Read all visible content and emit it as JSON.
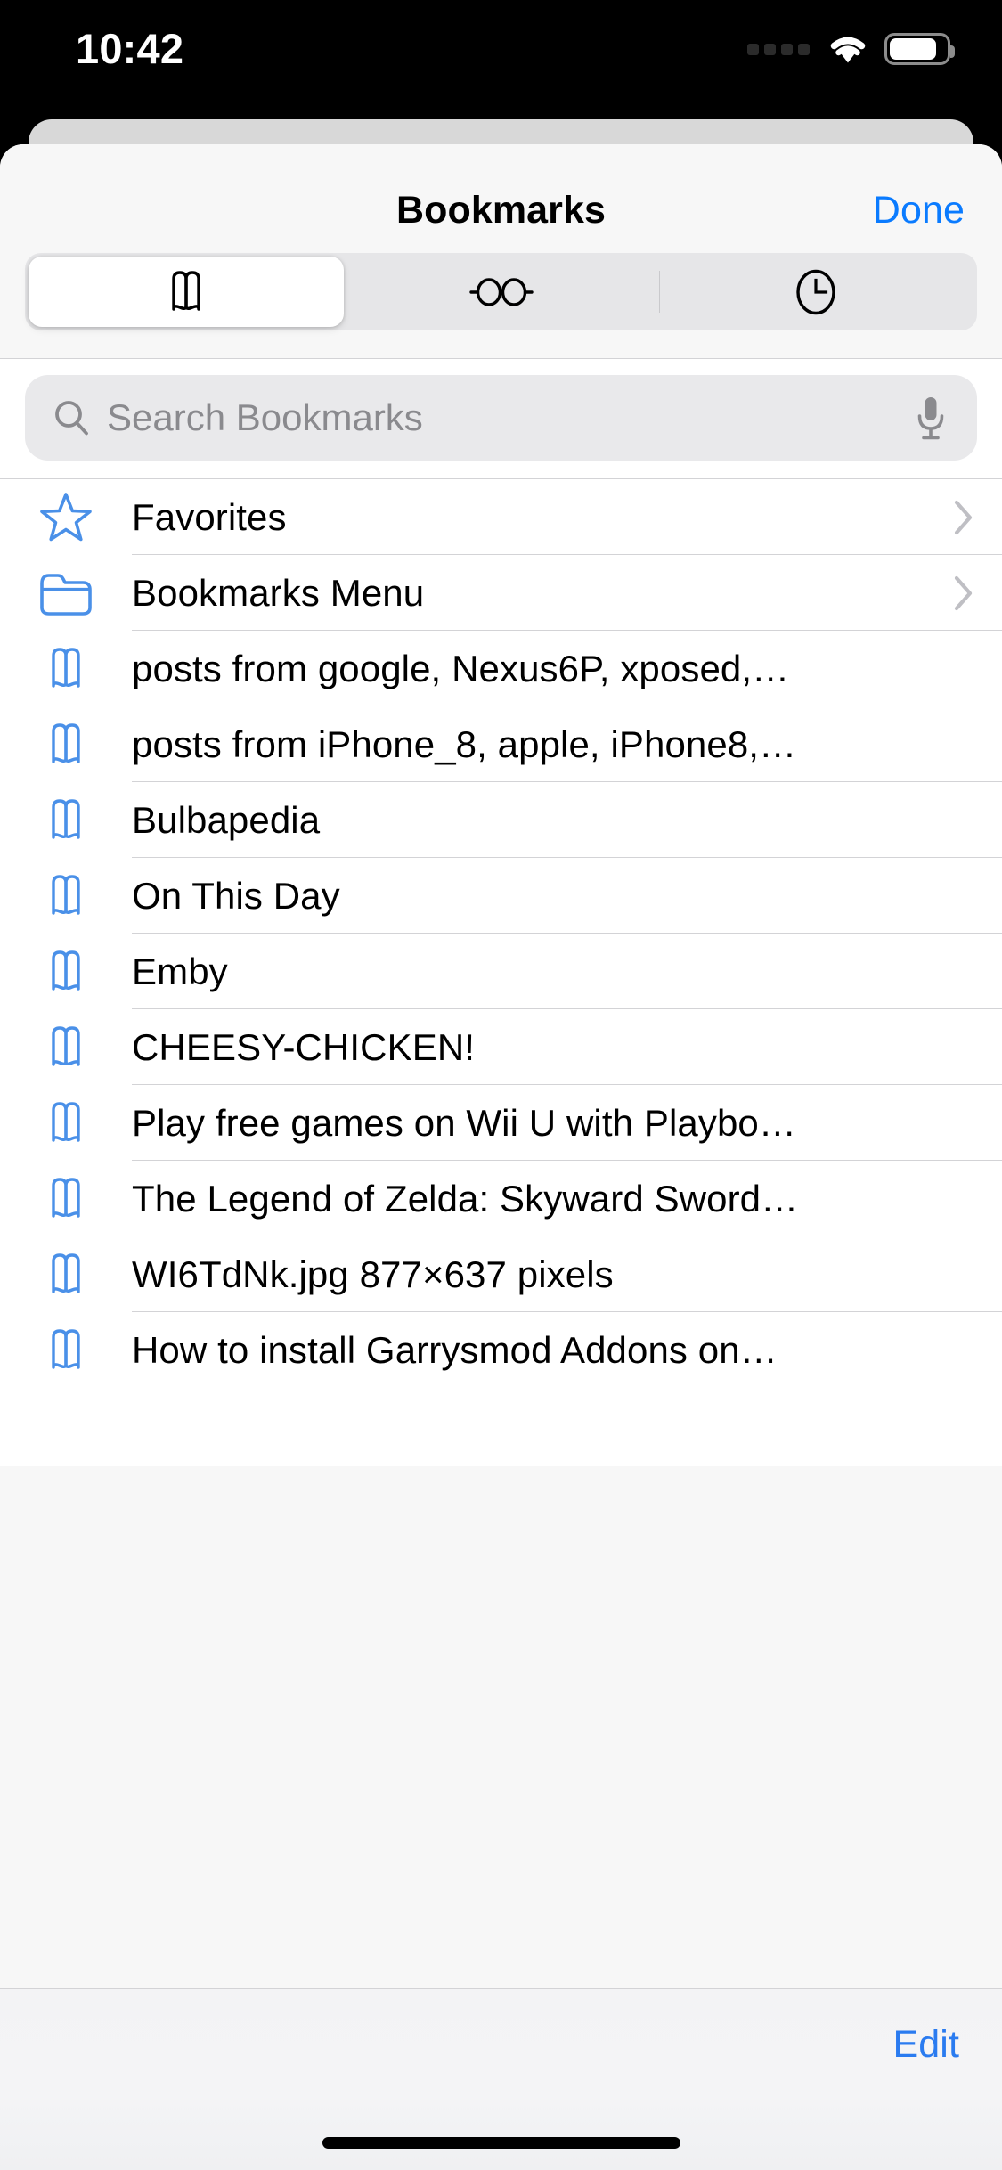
{
  "status_bar": {
    "time": "10:42",
    "signal_icon": "signal-dots-icon",
    "signal_dots": 4,
    "wifi_icon": "wifi-icon",
    "battery_icon": "battery-icon",
    "battery_level_percent": 75
  },
  "nav": {
    "title": "Bookmarks",
    "done_label": "Done"
  },
  "segmented_control": {
    "selected_index": 0,
    "tabs": [
      {
        "icon": "book-icon",
        "name": "bookmarks-tab",
        "selected": true
      },
      {
        "icon": "glasses-icon",
        "name": "reading-list-tab",
        "selected": false
      },
      {
        "icon": "clock-icon",
        "name": "history-tab",
        "selected": false
      }
    ]
  },
  "search": {
    "placeholder": "Search Bookmarks",
    "value": "",
    "search_icon": "search-icon",
    "mic_icon": "microphone-icon"
  },
  "list": {
    "rows": [
      {
        "label": "Favorites",
        "icon": "star-icon",
        "chevron": true
      },
      {
        "label": "Bookmarks Menu",
        "icon": "folder-icon",
        "chevron": true
      },
      {
        "label": "posts from google, Nexus6P, xposed,…",
        "icon": "book-icon",
        "chevron": false
      },
      {
        "label": "posts from iPhone_8, apple, iPhone8,…",
        "icon": "book-icon",
        "chevron": false
      },
      {
        "label": "Bulbapedia",
        "icon": "book-icon",
        "chevron": false
      },
      {
        "label": "On This Day",
        "icon": "book-icon",
        "chevron": false
      },
      {
        "label": "Emby",
        "icon": "book-icon",
        "chevron": false
      },
      {
        "label": "CHEESY-CHICKEN!",
        "icon": "book-icon",
        "chevron": false
      },
      {
        "label": "Play free games on Wii U with Playbo…",
        "icon": "book-icon",
        "chevron": false
      },
      {
        "label": "The Legend of Zelda: Skyward Sword…",
        "icon": "book-icon",
        "chevron": false
      },
      {
        "label": "WI6TdNk.jpg 877×637 pixels",
        "icon": "book-icon",
        "chevron": false
      },
      {
        "label": "How to install Garrysmod Addons on…",
        "icon": "book-icon",
        "chevron": false
      }
    ]
  },
  "toolbar": {
    "edit_label": "Edit"
  },
  "colors": {
    "accent_blue": "#0a7bff",
    "edit_blue": "#2a7bf0",
    "icon_blue": "#4a90e8",
    "sheet_bg": "#f7f7f7",
    "list_bg": "#ffffff",
    "separator": "#d3d3d6",
    "search_bg": "#e9e9eb",
    "segment_bg": "#e6e6e8",
    "placeholder_gray": "#8a8a8e"
  }
}
